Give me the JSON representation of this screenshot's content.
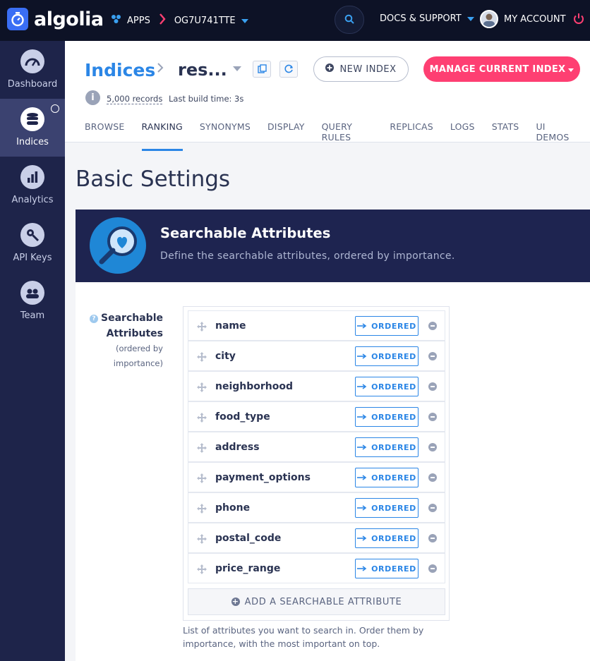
{
  "topbar": {
    "logo_text": "algolia",
    "apps_label": "APPS",
    "app_id": "OG7U741TTE",
    "docs_label": "DOCS & SUPPORT",
    "account_label": "MY ACCOUNT"
  },
  "sidebar": {
    "items": [
      {
        "label": "Dashboard",
        "icon": "gauge-icon"
      },
      {
        "label": "Indices",
        "icon": "database-icon",
        "active": true
      },
      {
        "label": "Analytics",
        "icon": "bar-chart-icon"
      },
      {
        "label": "API Keys",
        "icon": "key-icon"
      },
      {
        "label": "Team",
        "icon": "team-icon"
      }
    ]
  },
  "header": {
    "crumb_root": "Indices",
    "crumb_index": "res...",
    "new_index_label": "NEW INDEX",
    "manage_label": "MANAGE CURRENT INDEX",
    "records": "5,000 records",
    "build_time": "Last build time: 3s",
    "tabs": [
      "BROWSE",
      "RANKING",
      "SYNONYMS",
      "DISPLAY",
      "QUERY RULES",
      "REPLICAS",
      "LOGS",
      "STATS",
      "UI DEMOS"
    ],
    "active_tab": "RANKING"
  },
  "main": {
    "section_title": "Basic Settings",
    "card_title": "Searchable Attributes",
    "card_subtitle": "Define the searchable attributes, ordered by importance.",
    "field_label_1": "Searchable",
    "field_label_2": "Attributes",
    "field_hint_1": "(ordered by",
    "field_hint_2": "importance)",
    "attributes": [
      "name",
      "city",
      "neighborhood",
      "food_type",
      "address",
      "payment_options",
      "phone",
      "postal_code",
      "price_range"
    ],
    "ordered_label": "ORDERED",
    "add_label": "ADD A SEARCHABLE ATTRIBUTE",
    "help_text": "List of attributes you want to search in. Order them by importance, with the most important on top."
  },
  "colors": {
    "accent": "#2b86e6",
    "brand_pink": "#fe3f72",
    "sidebar": "#1e244a",
    "topbar": "#0d1226"
  }
}
